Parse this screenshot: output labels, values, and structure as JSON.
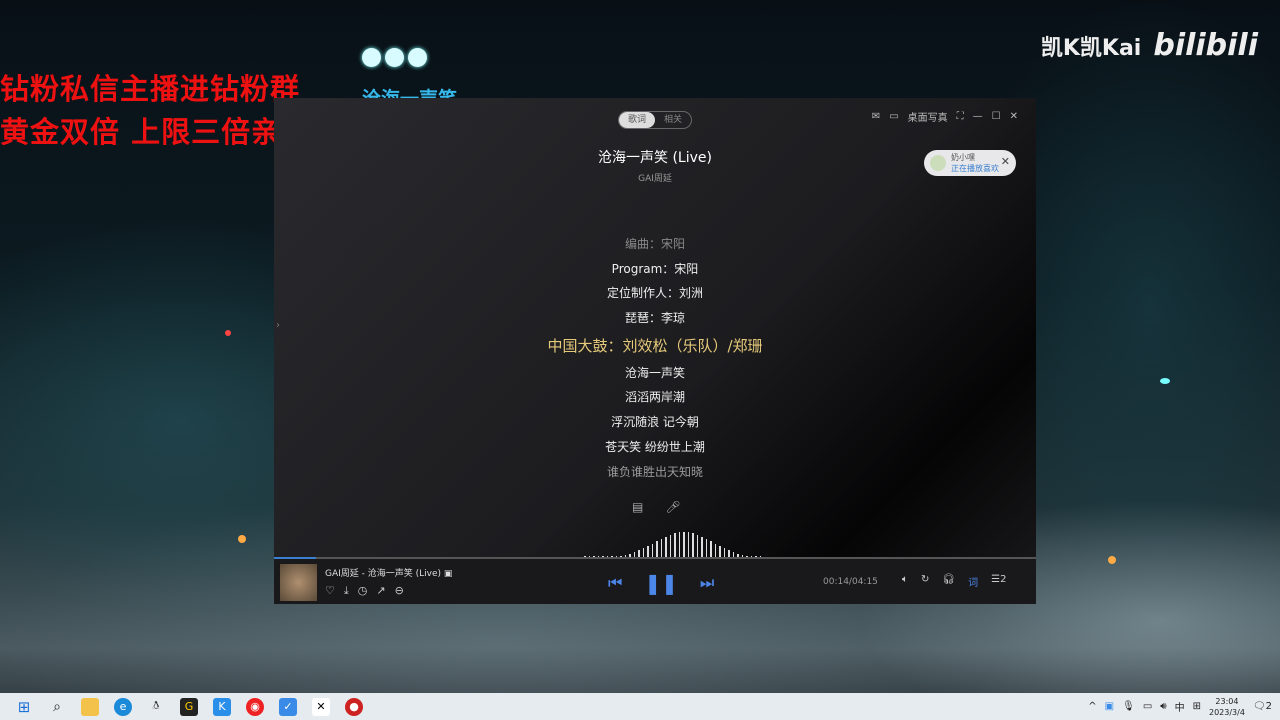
{
  "overlay": {
    "line1": "钻粉私信主播进钻粉群",
    "line2": "黄金双倍 上限三倍亲密度",
    "song_tag": "沧海一声笑",
    "watermark": "凯K凯Kai",
    "brand": "bilibili"
  },
  "player": {
    "tabs": [
      {
        "label": "歌词",
        "active": true
      },
      {
        "label": "相关",
        "active": false
      }
    ],
    "desktop_lyrics": "桌面写真",
    "title": "沧海一声笑 (Live)",
    "artist": "GAI周延",
    "notification": {
      "name": "奶小嘿",
      "status": "正在播放喜欢"
    },
    "lyrics": [
      {
        "text": "编曲：宋阳",
        "state": "dim"
      },
      {
        "text": "Program：宋阳",
        "state": ""
      },
      {
        "text": "定位制作人：刘洲",
        "state": ""
      },
      {
        "text": "琵琶：李琼",
        "state": ""
      },
      {
        "text": "中国大鼓：刘效松（乐队）/郑珊",
        "state": "cur"
      },
      {
        "text": "沧海一声笑",
        "state": ""
      },
      {
        "text": "滔滔两岸潮",
        "state": ""
      },
      {
        "text": "浮沉随浪 记今朝",
        "state": ""
      },
      {
        "text": "苍天笑 纷纷世上潮",
        "state": ""
      },
      {
        "text": "谁负谁胜出天知晓",
        "state": "fade"
      }
    ],
    "now_playing": "GAI周延 - 沧海一声笑 (Live)",
    "time": "00:14/04:15",
    "progress": 0.055,
    "lyric_btn": "词",
    "queue_count": "2"
  },
  "taskbar": {
    "ime": "中",
    "time": "23:04",
    "date": "2023/3/4",
    "notif_count": "2"
  }
}
